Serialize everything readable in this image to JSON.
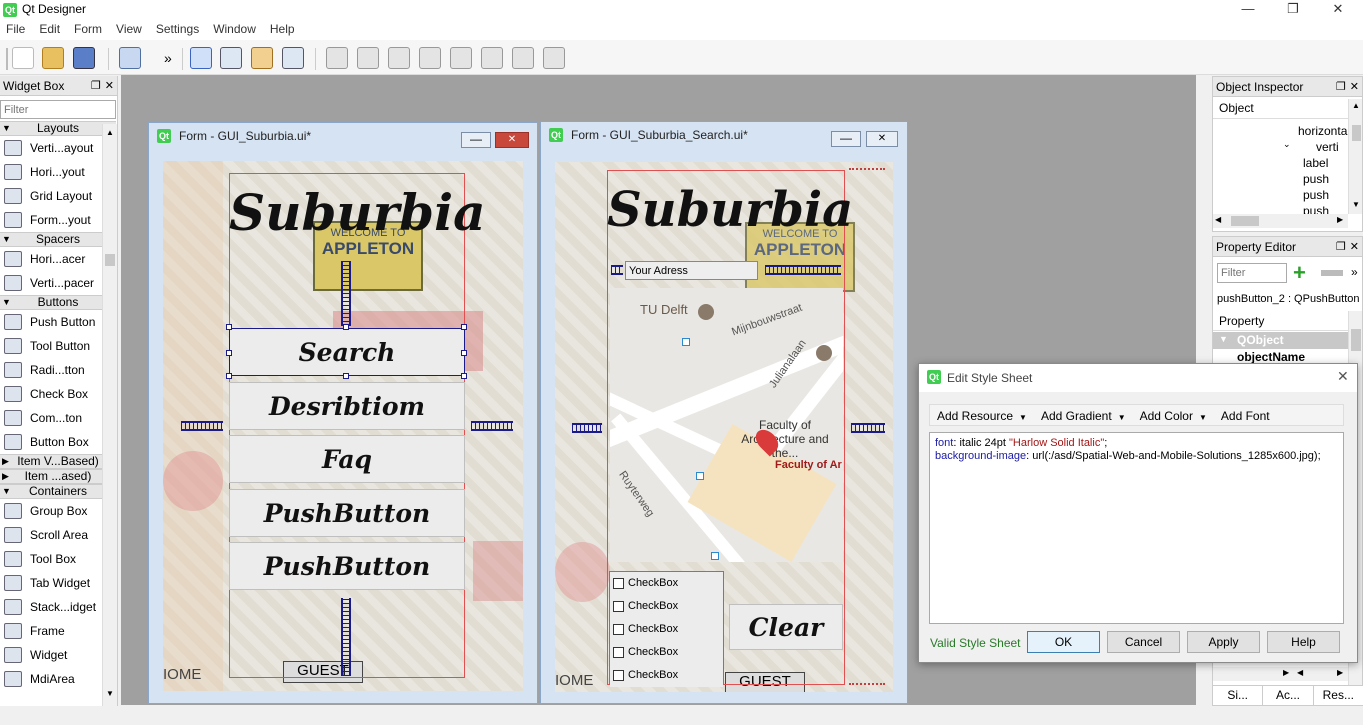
{
  "app": {
    "title": "Qt Designer",
    "icon_text": "Qt"
  },
  "menu": [
    "File",
    "Edit",
    "Form",
    "View",
    "Settings",
    "Window",
    "Help"
  ],
  "toolbar": {
    "overflow": "»"
  },
  "widget_box": {
    "title": "Widget Box",
    "filter_placeholder": "Filter",
    "categories": [
      {
        "label": "Layouts",
        "items": [
          "Verti...ayout",
          "Hori...yout",
          "Grid Layout",
          "Form...yout"
        ]
      },
      {
        "label": "Spacers",
        "items": [
          "Hori...acer",
          "Verti...pacer"
        ]
      },
      {
        "label": "Buttons",
        "items": [
          "Push Button",
          "Tool Button",
          "Radi...tton",
          "Check Box",
          "Com...ton",
          "Button Box"
        ]
      },
      {
        "label": "Item V...Based)",
        "items": []
      },
      {
        "label": "Item ...ased)",
        "items": []
      },
      {
        "label": "Containers",
        "items": [
          "Group Box",
          "Scroll Area",
          "Tool Box",
          "Tab Widget",
          "Stack...idget",
          "Frame",
          "Widget",
          "MdiArea"
        ]
      }
    ]
  },
  "form1": {
    "title": "Form - GUI_Suburbia.ui*",
    "heading": "Suburbia",
    "sign_text": "WELCOME TO",
    "sign_name": "APPLETON",
    "buttons": [
      "Search",
      "Desribtiom",
      "Faq",
      "PushButton",
      "PushButton"
    ],
    "bottom_sign": "GUEST",
    "bottom_left": "IOME"
  },
  "form2": {
    "title": "Form - GUI_Suburbia_Search.ui*",
    "heading": "Suburbia",
    "address": "Your Adress",
    "map_labels": {
      "poi1": "TU Delft",
      "street1": "Mijnbouwstraat",
      "street2": "Julianalaan",
      "street3": "Ruyterweg",
      "faculty": "Faculty of Architecture and the...",
      "marker": "Faculty of Ar"
    },
    "checkboxes": [
      "CheckBox",
      "CheckBox",
      "CheckBox",
      "CheckBox",
      "CheckBox"
    ],
    "clear_button": "Clear",
    "bottom_sign": "GUEST",
    "bottom_left": "IOME"
  },
  "object_inspector": {
    "title": "Object Inspector",
    "column": "Object",
    "rows": [
      "horizonta",
      "verti",
      "label",
      "push",
      "push",
      "push"
    ]
  },
  "property_editor": {
    "title": "Property Editor",
    "filter_placeholder": "Filter",
    "current": "pushButton_2 : QPushButton",
    "column": "Property",
    "section": "QObject",
    "row": "objectName"
  },
  "dialog": {
    "title": "Edit Style Sheet",
    "toolbar": [
      "Add Resource",
      "Add Gradient",
      "Add Color",
      "Add Font"
    ],
    "line1_prop": "font",
    "line1_rest": ": italic 24pt ",
    "line1_str": "\"Harlow Solid Italic\"",
    "line1_end": ";",
    "line2_prop": "background-image",
    "line2_rest": ": url(:/asd/Spatial-Web-and-Mobile-Solutions_1285x600.jpg);",
    "status": "Valid Style Sheet",
    "buttons": {
      "ok": "OK",
      "cancel": "Cancel",
      "apply": "Apply",
      "help": "Help"
    }
  },
  "bottom_tabs": [
    "Si...",
    "Ac...",
    "Res..."
  ],
  "colors": {
    "valid": "#2a7a2a",
    "keyword": "#1a1aa6",
    "string": "#a31515",
    "qobject": "#c8c8c8"
  }
}
